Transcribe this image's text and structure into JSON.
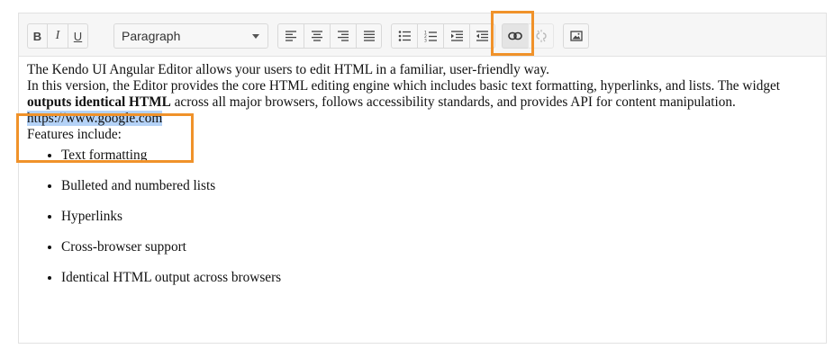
{
  "toolbar": {
    "bold_label": "B",
    "italic_label": "I",
    "underline_label": "U",
    "format_select_value": "Paragraph",
    "icons": {
      "align_left": "align-left-icon",
      "align_center": "align-center-icon",
      "align_right": "align-right-icon",
      "align_justify": "align-justify-icon",
      "bulleted_list": "bulleted-list-icon",
      "numbered_list": "numbered-list-icon",
      "indent": "indent-icon",
      "outdent": "outdent-icon",
      "insert_link": "link-icon",
      "unlink": "unlink-icon",
      "insert_image": "image-icon"
    }
  },
  "content": {
    "intro_line1": "The Kendo UI Angular Editor allows your users to edit HTML in a familiar, user-friendly way.",
    "intro_line2_part1": "In this version, the Editor provides the core HTML editing engine which includes basic text formatting, hyperlinks, and lists. The widget ",
    "intro_bold": "outputs identical HTML",
    "intro_line2_part2": " across all major browsers, follows accessibility standards, and provides API for content manipulation.",
    "selected_link_text": "https://www.google.com",
    "features_heading": "Features include:",
    "features": [
      "Text formatting",
      "Bulleted and numbered lists",
      "Hyperlinks",
      "Cross-browser support",
      "Identical HTML output across browsers"
    ]
  },
  "colors": {
    "highlight": "#f0922a",
    "selection": "#b4d2f7",
    "toolbar_bg": "#f6f6f6"
  }
}
